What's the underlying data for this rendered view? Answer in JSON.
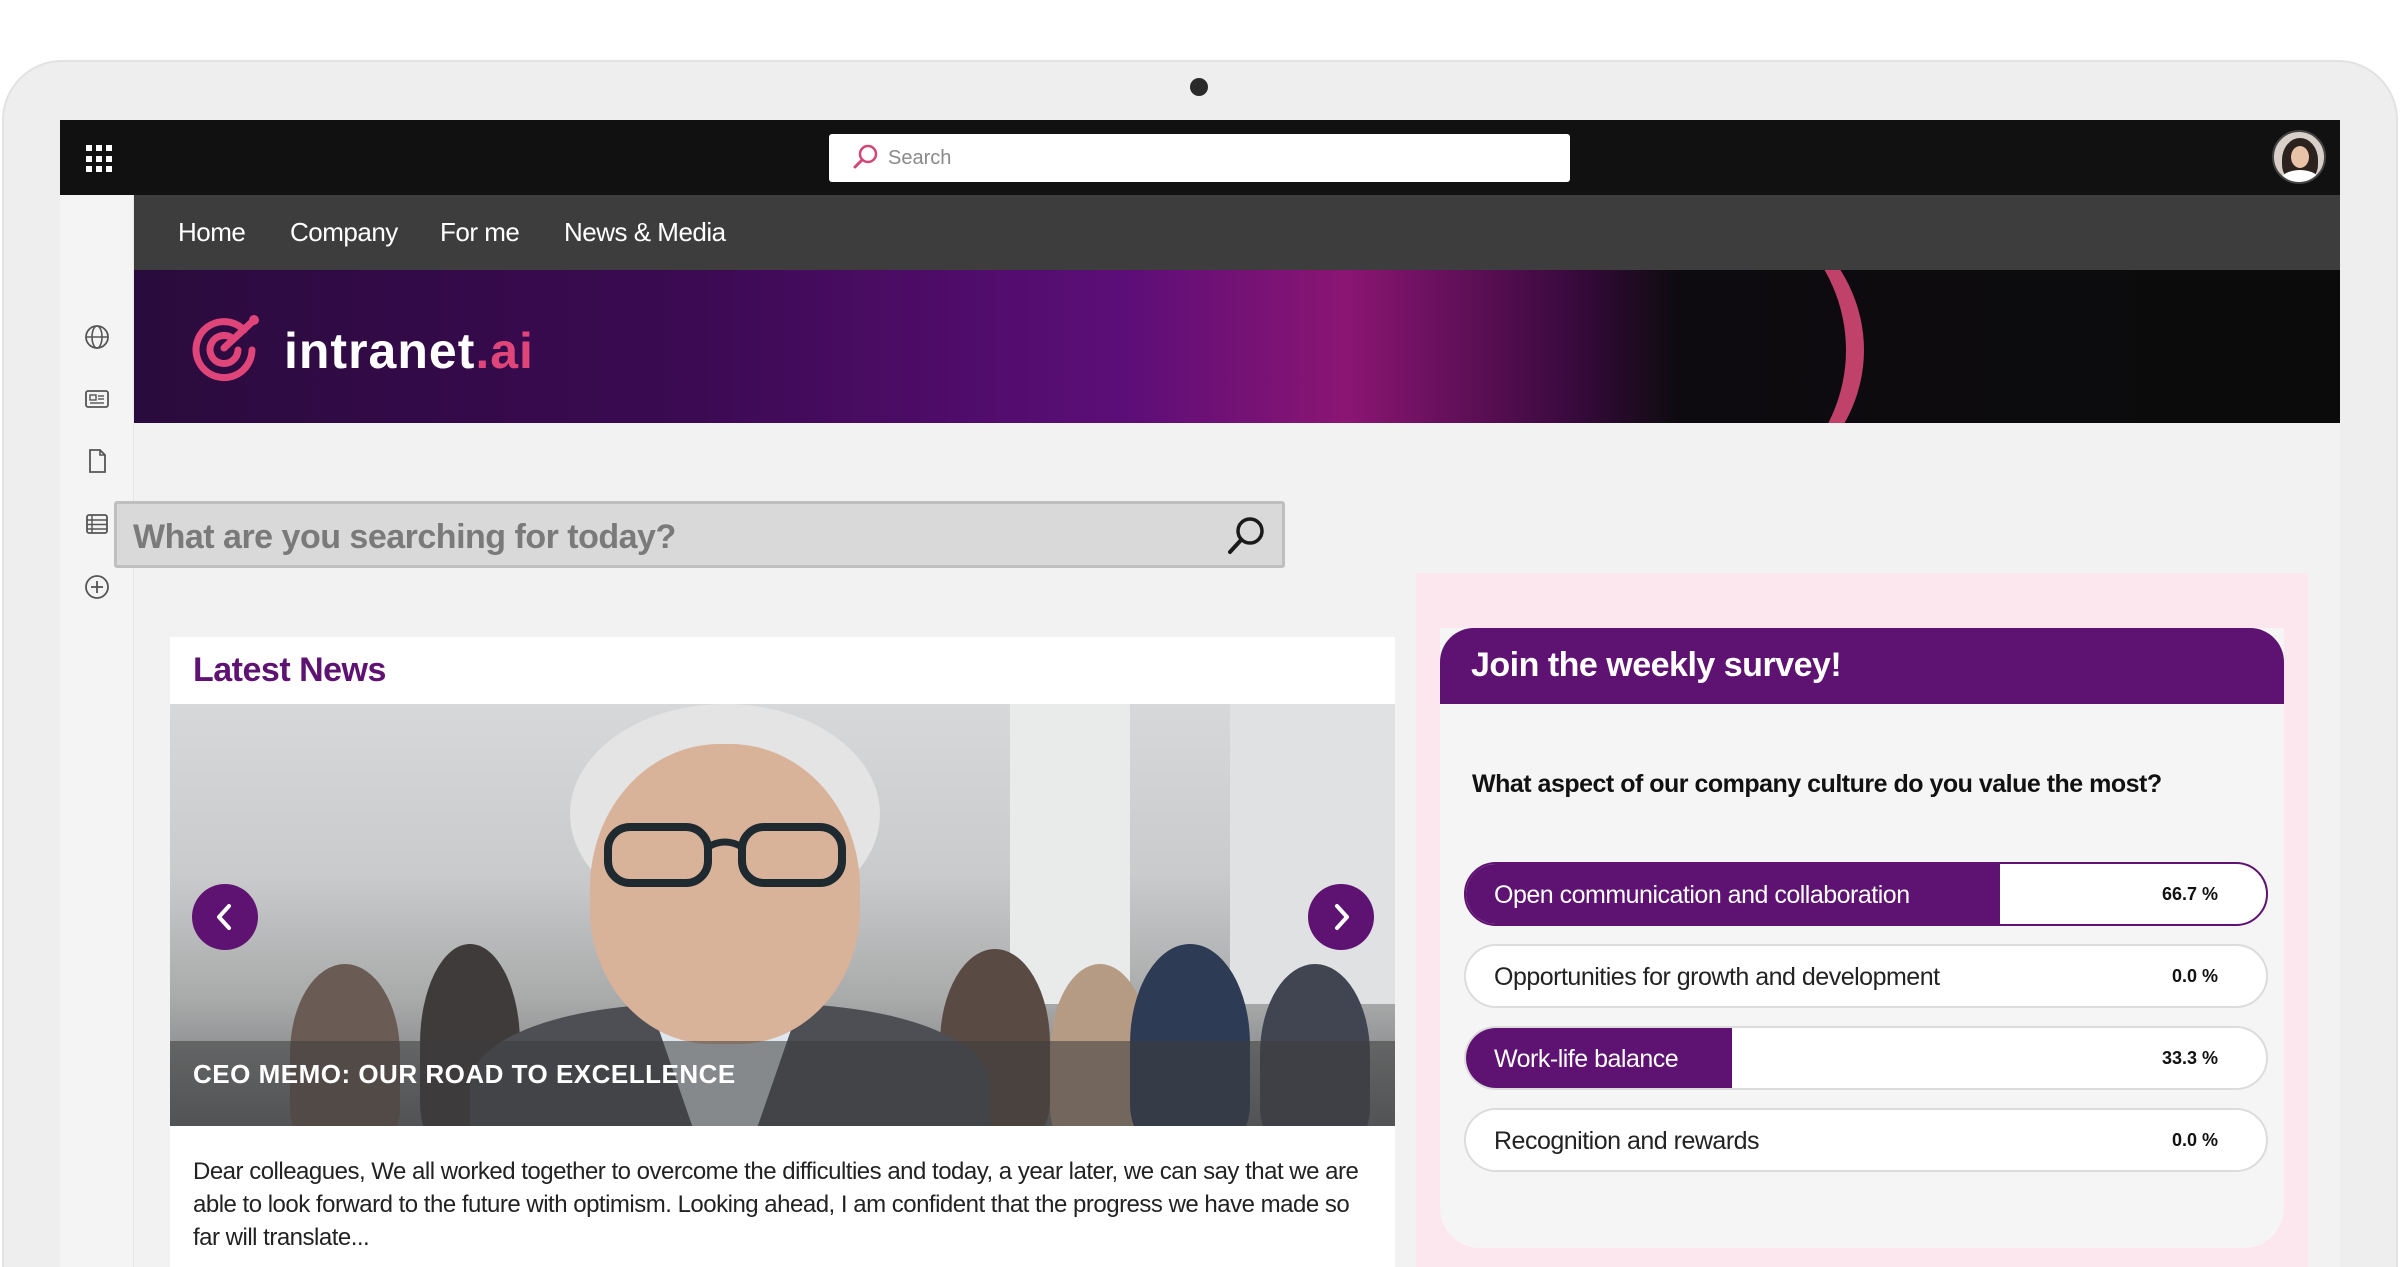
{
  "topbar": {
    "search_placeholder": "Search"
  },
  "nav": {
    "items": [
      "Home",
      "Company",
      "For me",
      "News & Media"
    ]
  },
  "brand": {
    "name": "intranet",
    "suffix": ".ai",
    "accent_color": "#e0457a",
    "primary_color": "#5e1272"
  },
  "rail": {
    "icons": [
      "globe-icon",
      "news-icon",
      "document-icon",
      "list-icon",
      "add-circle-icon"
    ]
  },
  "main_search": {
    "placeholder": "What are you searching for today?"
  },
  "news": {
    "heading": "Latest News",
    "headline": "CEO MEMO: OUR ROAD TO EXCELLENCE",
    "excerpt": "Dear colleagues, We all worked together to overcome the difficulties and today, a year later, we can say that we are able to look forward to the future with optimism. Looking ahead, I am confident that the progress we have made so far will translate..."
  },
  "survey": {
    "title": "Join the weekly survey!",
    "question": "What aspect of our company culture do you value the most?",
    "options": [
      {
        "label": "Open communication and collaboration",
        "percent_text": "66.7 %",
        "fraction": 0.667,
        "selected": true
      },
      {
        "label": "Opportunities for growth and development",
        "percent_text": "0.0 %",
        "fraction": 0.0,
        "selected": false
      },
      {
        "label": "Work-life balance",
        "percent_text": "33.3 %",
        "fraction": 0.333,
        "selected": false
      },
      {
        "label": "Recognition and rewards",
        "percent_text": "0.0 %",
        "fraction": 0.0,
        "selected": false
      }
    ]
  }
}
